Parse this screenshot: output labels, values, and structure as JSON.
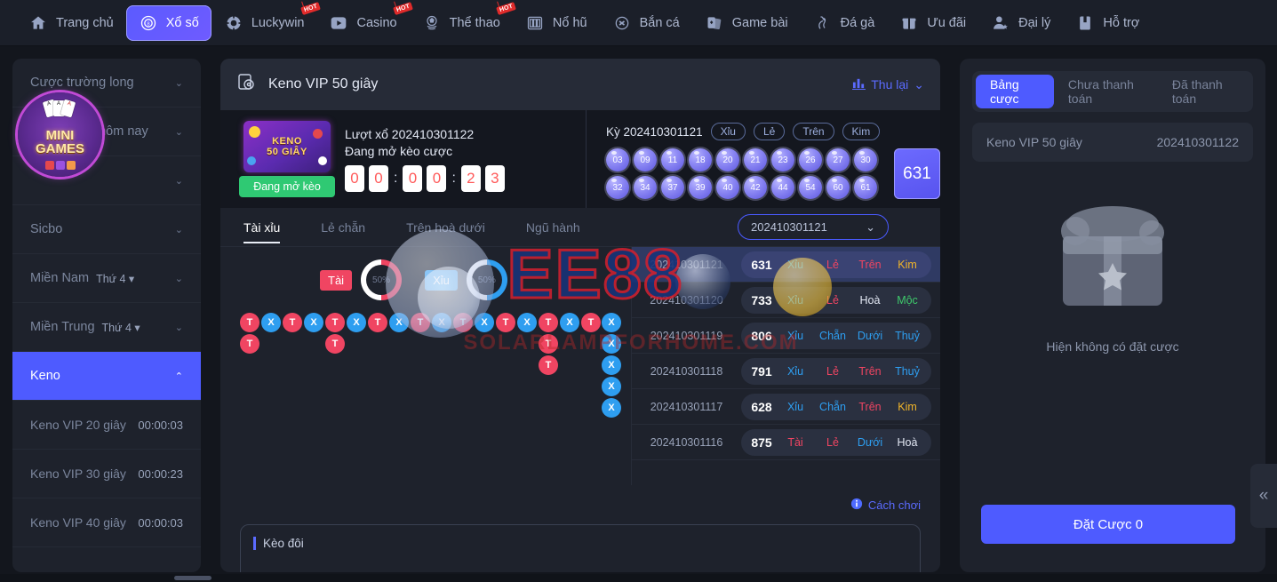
{
  "topnav": {
    "items": [
      {
        "label": "Trang chủ",
        "icon": "home-icon",
        "active": false,
        "hot": false
      },
      {
        "label": "Xổ số",
        "icon": "lottery-ball-icon",
        "active": true,
        "hot": false
      },
      {
        "label": "Luckywin",
        "icon": "chip-icon",
        "active": false,
        "hot": true
      },
      {
        "label": "Casino",
        "icon": "play-icon",
        "active": false,
        "hot": true
      },
      {
        "label": "Thể thao",
        "icon": "soccer-icon",
        "active": false,
        "hot": true
      },
      {
        "label": "Nổ hũ",
        "icon": "slot-machine-icon",
        "active": false,
        "hot": false
      },
      {
        "label": "Bắn cá",
        "icon": "fish-icon",
        "active": false,
        "hot": false
      },
      {
        "label": "Game bài",
        "icon": "cards-icon",
        "active": false,
        "hot": false
      },
      {
        "label": "Đá gà",
        "icon": "rooster-icon",
        "active": false,
        "hot": false
      },
      {
        "label": "Ưu đãi",
        "icon": "gift-icon",
        "active": false,
        "hot": false
      },
      {
        "label": "Đại lý",
        "icon": "agent-user-icon",
        "active": false,
        "hot": false
      },
      {
        "label": "Hỗ trợ",
        "icon": "support-book-icon",
        "active": false,
        "hot": false
      }
    ]
  },
  "sidebar": {
    "groups": [
      {
        "label": "Cược trường long",
        "day": "",
        "expanded": false
      },
      {
        "label": "Mở thưởng hôm nay",
        "day": "",
        "expanded": false
      },
      {
        "label": "",
        "day": "",
        "expanded": false
      },
      {
        "label": "Sicbo",
        "day": "",
        "expanded": false
      },
      {
        "label": "Miền Nam",
        "day": "Thứ 4",
        "expanded": false
      },
      {
        "label": "Miền Trung",
        "day": "Thứ 4",
        "expanded": false
      }
    ],
    "active_group": {
      "label": "Keno",
      "expanded": true
    },
    "keno_items": [
      {
        "label": "Keno VIP 20 giây",
        "time": "00:00:03"
      },
      {
        "label": "Keno VIP 30 giây",
        "time": "00:00:23"
      },
      {
        "label": "Keno VIP 40 giây",
        "time": "00:00:03"
      }
    ],
    "minigames_badge": {
      "line1": "MINI",
      "line2": "GAMES"
    }
  },
  "center": {
    "title": "Keno VIP 50 giây",
    "collapse_label": "Thu lại",
    "round": {
      "draw_label": "Lượt xổ 202410301122",
      "status_label": "Đang mở kèo cược",
      "open_badge": "Đang mở kèo",
      "badge_line1": "KENO",
      "badge_line2": "50 GIÂY",
      "timer": [
        "0",
        "0",
        "0",
        "0",
        "2",
        "3"
      ]
    },
    "previous": {
      "period_label": "Kỳ 202410301121",
      "tags": [
        "Xỉu",
        "Lẻ",
        "Trên",
        "Kim"
      ],
      "balls": [
        "03",
        "09",
        "11",
        "18",
        "20",
        "21",
        "23",
        "26",
        "27",
        "30",
        "32",
        "34",
        "37",
        "39",
        "40",
        "42",
        "44",
        "54",
        "60",
        "61"
      ],
      "sum": "631"
    },
    "tabs": [
      {
        "label": "Tài xỉu",
        "active": true
      },
      {
        "label": "Lẻ chẵn",
        "active": false
      },
      {
        "label": "Trên hoà dưới",
        "active": false
      },
      {
        "label": "Ngũ hành",
        "active": false
      }
    ],
    "period_select": "202410301121",
    "road": {
      "tai_label": "Tài",
      "tai_pct": "50%",
      "xiu_label": "Xỉu",
      "xiu_pct": "50%",
      "columns": [
        [
          "T",
          "T"
        ],
        [
          "X"
        ],
        [
          "T"
        ],
        [
          "X"
        ],
        [
          "T",
          "T"
        ],
        [
          "X"
        ],
        [
          "T"
        ],
        [
          "X"
        ],
        [
          "T"
        ],
        [
          "X"
        ],
        [
          "T"
        ],
        [
          "X"
        ],
        [
          "T"
        ],
        [
          "X"
        ],
        [
          "T",
          "T",
          "T"
        ],
        [
          "X"
        ],
        [
          "T"
        ],
        [
          "X",
          "X",
          "X",
          "X",
          "X"
        ]
      ]
    },
    "results_header_hidden": true,
    "results": [
      {
        "period": "202410301121",
        "num": "631",
        "c1": "Xỉu",
        "c2": "Lẻ",
        "c3": "Trên",
        "c4": "Kim",
        "highlight": true
      },
      {
        "period": "202410301120",
        "num": "733",
        "c1": "Xỉu",
        "c2": "Lẻ",
        "c3": "Hoà",
        "c4": "Mộc",
        "highlight": false
      },
      {
        "period": "202410301119",
        "num": "806",
        "c1": "Xỉu",
        "c2": "Chẵn",
        "c3": "Dưới",
        "c4": "Thuỷ",
        "highlight": false
      },
      {
        "period": "202410301118",
        "num": "791",
        "c1": "Xỉu",
        "c2": "Lẻ",
        "c3": "Trên",
        "c4": "Thuỷ",
        "highlight": false
      },
      {
        "period": "202410301117",
        "num": "628",
        "c1": "Xỉu",
        "c2": "Chẵn",
        "c3": "Trên",
        "c4": "Kim",
        "highlight": false
      },
      {
        "period": "202410301116",
        "num": "875",
        "c1": "Tài",
        "c2": "Lẻ",
        "c3": "Dưới",
        "c4": "Hoà",
        "highlight": false
      }
    ],
    "howto_label": "Cách chơi",
    "keodoi_label": "Kèo đôi"
  },
  "right": {
    "tabs": [
      {
        "label": "Bảng cược",
        "active": true
      },
      {
        "label": "Chưa thanh toán",
        "active": false
      },
      {
        "label": "Đã thanh toán",
        "active": false
      }
    ],
    "bar": {
      "game": "Keno VIP 50 giây",
      "period": "202410301122"
    },
    "empty_text": "Hiện không có đặt cược",
    "bet_button": "Đặt Cược 0"
  },
  "watermarks": {
    "brand": "EE88",
    "url": "SOLARLAMPFORHOME.COM"
  },
  "colors": {
    "accent": "#4e5bff",
    "tai": "#f04562",
    "xiu": "#2e9ef0",
    "green": "#2fc973",
    "kim": "#f0b429",
    "moc": "#3ec96b",
    "hoa": "#f04562",
    "thuy": "#2e9ef0"
  }
}
